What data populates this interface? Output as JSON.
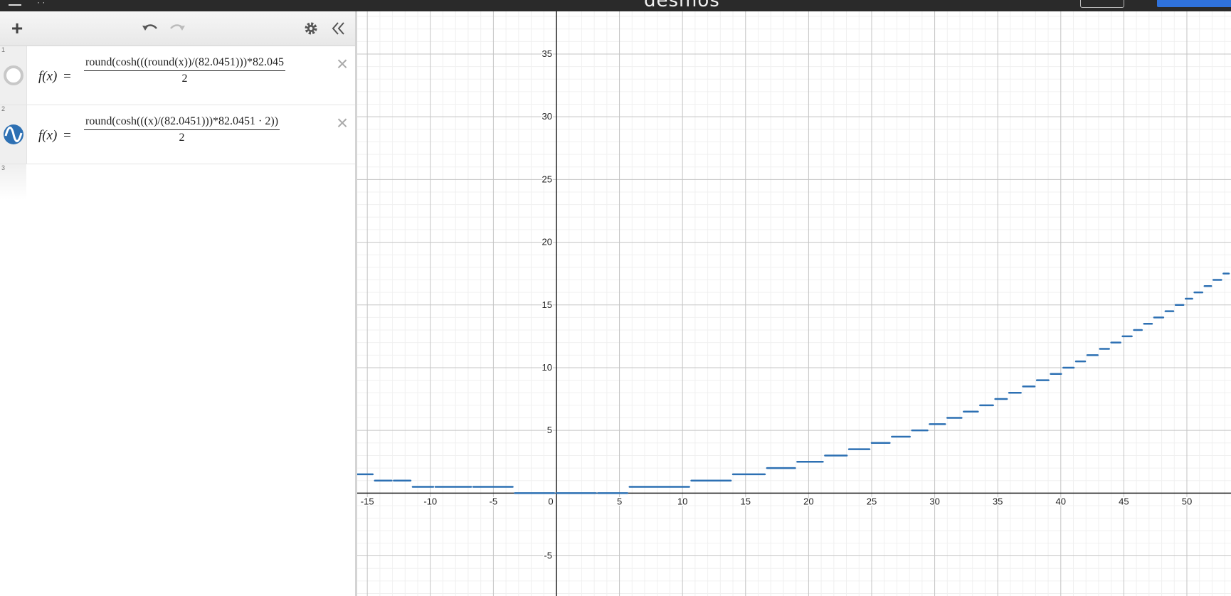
{
  "app": {
    "title": "desmos",
    "accent": "#2f72dc"
  },
  "toolbar": {
    "add_icon": "plus-icon",
    "undo_icon": "undo-icon",
    "redo_icon": "redo-icon",
    "settings_icon": "gear-icon",
    "collapse_icon": "double-chevron-left-icon"
  },
  "expressions": [
    {
      "index": "1",
      "lhs": "f(x)",
      "numerator": "round(cosh(((round(x))/(82.0451)))*82.045",
      "denominator": "2",
      "icon": "hidden-graph-circle-icon",
      "visible": false,
      "color": "#c8c8c8"
    },
    {
      "index": "2",
      "lhs": "f(x)",
      "numerator": "round(cosh(((x)/(82.0451)))*82.0451 · 2))",
      "denominator": "2",
      "icon": "wave-graph-icon",
      "visible": true,
      "color": "#2d70b3"
    },
    {
      "index": "3",
      "lhs": "",
      "numerator": "",
      "denominator": ""
    }
  ],
  "chart_data": {
    "type": "line",
    "xlim": [
      -15.8,
      53.5
    ],
    "ylim": [
      -8.2,
      38.4
    ],
    "grid": true,
    "x_ticks": [
      -15,
      -10,
      -5,
      0,
      5,
      10,
      15,
      20,
      25,
      30,
      35,
      40,
      45,
      50
    ],
    "y_ticks": [
      -5,
      5,
      10,
      15,
      20,
      25,
      30,
      35
    ],
    "series": [
      {
        "color": "#2d70b3",
        "style": "step",
        "formula": "round(cosh(x/82.0451)*82.0451*2)/2 - 82.0451 offset (stepwise half-integer)",
        "x": [
          -15.8,
          -14.4,
          -12.9,
          -11.4,
          -9.6,
          -6.6,
          -3.3,
          0,
          3.3,
          5.8,
          10.7,
          14.0,
          16.7,
          19.1,
          21.3,
          23.2,
          25.0,
          26.6,
          28.2,
          29.6,
          31.0,
          32.3,
          33.6,
          34.8,
          35.9,
          37.0,
          38.1,
          39.2,
          40.2,
          41.2,
          42.1,
          43.1,
          44.0,
          44.9,
          45.8,
          46.6,
          47.4,
          48.3,
          49.1,
          49.9,
          50.6,
          51.4,
          52.1,
          52.9,
          53.5
        ],
        "y": [
          1.5,
          1.0,
          1.0,
          0.5,
          0.5,
          0.5,
          0.0,
          0.0,
          0.0,
          0.5,
          1.0,
          1.5,
          2.0,
          2.5,
          3.0,
          3.5,
          4.0,
          4.5,
          5.0,
          5.5,
          6.0,
          6.5,
          7.0,
          7.5,
          8.0,
          8.5,
          9.0,
          9.5,
          10.0,
          10.5,
          11.0,
          11.5,
          12.0,
          12.5,
          13.0,
          13.5,
          14.0,
          14.5,
          15.0,
          15.5,
          16.0,
          16.5,
          17.0,
          17.5,
          18.0
        ]
      }
    ]
  }
}
